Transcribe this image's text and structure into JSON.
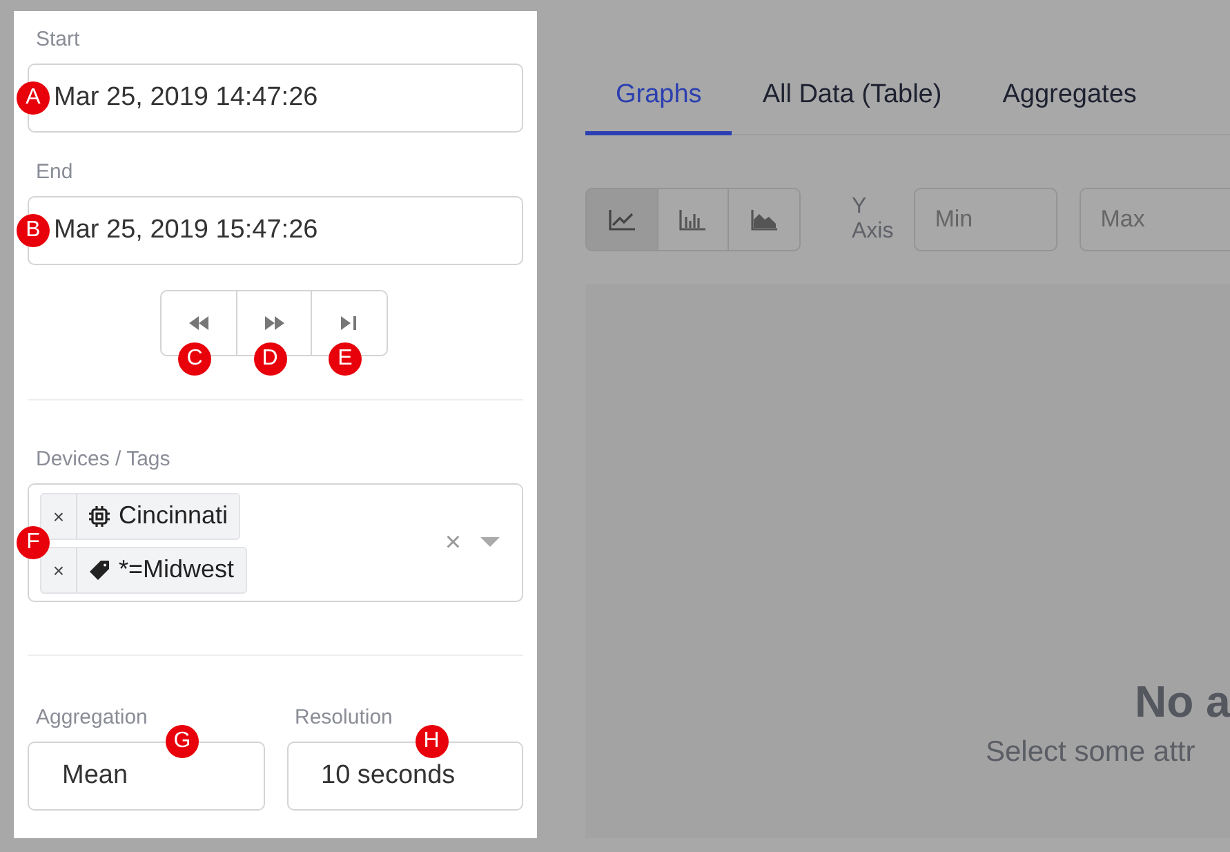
{
  "sidebar": {
    "start": {
      "label": "Start",
      "value": "Mar 25, 2019 14:47:26",
      "marker": "A"
    },
    "end": {
      "label": "End",
      "value": "Mar 25, 2019 15:47:26",
      "marker": "B"
    },
    "step_buttons": [
      {
        "kind": "back",
        "marker": "C"
      },
      {
        "kind": "forward",
        "marker": "D"
      },
      {
        "kind": "latest",
        "marker": "E"
      }
    ],
    "devices": {
      "label": "Devices / Tags",
      "marker": "F",
      "clear": "×",
      "chips": [
        {
          "kind": "device",
          "remove": "×",
          "text": "Cincinnati"
        },
        {
          "kind": "tag",
          "remove": "×",
          "text": "*=Midwest"
        }
      ]
    },
    "aggregation": {
      "label": "Aggregation",
      "value": "Mean",
      "marker": "G"
    },
    "resolution": {
      "label": "Resolution",
      "value": "10 seconds",
      "marker": "H"
    }
  },
  "tabs": [
    {
      "label": "Graphs",
      "selected": true
    },
    {
      "label": "All Data (Table)",
      "selected": false
    },
    {
      "label": "Aggregates",
      "selected": false
    }
  ],
  "toolbar": {
    "chart_types": [
      {
        "kind": "line",
        "selected": true
      },
      {
        "kind": "bar",
        "selected": false
      },
      {
        "kind": "area",
        "selected": false
      }
    ],
    "y_axis_label": "Y Axis",
    "min_placeholder": "Min",
    "max_placeholder": "Max"
  },
  "empty_state": {
    "title": "No a",
    "message": "Select some attr"
  }
}
